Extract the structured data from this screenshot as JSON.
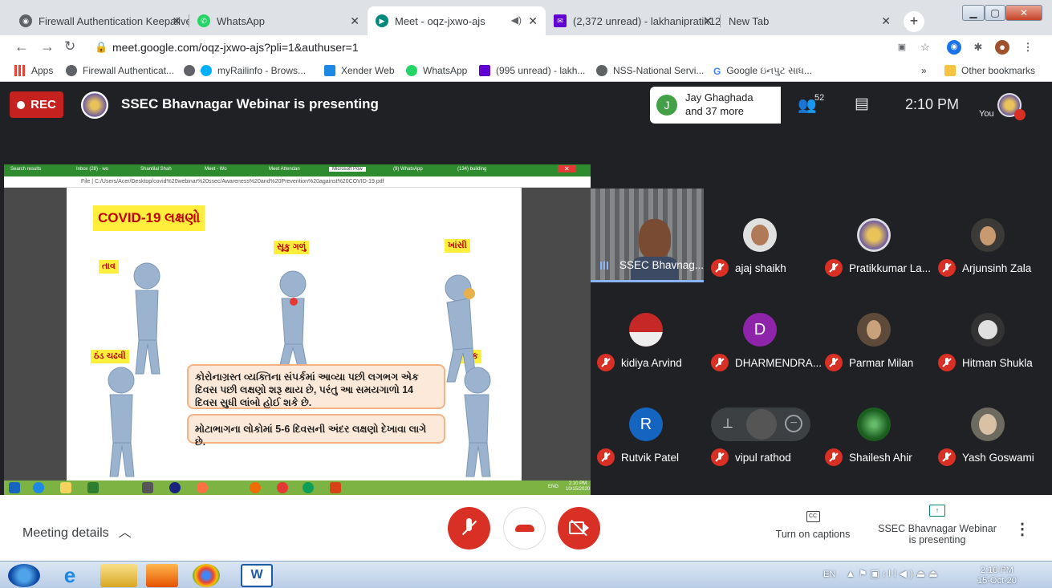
{
  "browser": {
    "tabs": [
      {
        "title": "Firewall Authentication Keepalive",
        "icon": "globe-icon"
      },
      {
        "title": "WhatsApp",
        "icon": "whatsapp-icon"
      },
      {
        "title": "Meet - oqz-jxwo-ajs",
        "icon": "meet-icon",
        "active": true
      },
      {
        "title": "(2,372 unread) - lakhanipratik12",
        "icon": "mail-icon"
      },
      {
        "title": "New Tab",
        "icon": ""
      }
    ],
    "url": "meet.google.com/oqz-jxwo-ajs?pli=1&authuser=1",
    "bookmarks": [
      "Apps",
      "Firewall Authenticat...",
      "myRailinfo - Brows...",
      "Xender Web",
      "WhatsApp",
      "(995 unread) - lakh...",
      "NSS-National Servi...",
      "Google ઇનપુટ સાધ..."
    ],
    "other_bookmarks": "Other bookmarks",
    "more_chevron": "»"
  },
  "meet": {
    "rec_label": "REC",
    "presenting_title": "SSEC Bhavnagar Webinar is presenting",
    "participants_summary_line1": "Jay Ghaghada",
    "participants_summary_line2": "and 37 more",
    "participant_count": "52",
    "time": "2:10 PM",
    "you_label": "You",
    "participants": [
      {
        "name": "SSEC Bhavnag...",
        "speaking": true
      },
      {
        "name": "ajaj shaikh"
      },
      {
        "name": "Pratikkumar La..."
      },
      {
        "name": "Arjunsinh Zala"
      },
      {
        "name": "kidiya Arvind"
      },
      {
        "name": "DHARMENDRA...",
        "initial": "D"
      },
      {
        "name": "Parmar Milan"
      },
      {
        "name": "Hitman Shukla"
      },
      {
        "name": "Rutvik Patel",
        "initial": "R"
      },
      {
        "name": "vipul rathod"
      },
      {
        "name": "Shailesh Ahir"
      },
      {
        "name": "Yash Goswami"
      }
    ],
    "bottom": {
      "meeting_details": "Meeting details",
      "captions": "Turn on captions",
      "captions_icon_text": "CC",
      "presenting_line1": "SSEC Bhavnagar Webinar",
      "presenting_line2": "is presenting"
    }
  },
  "shared_screen": {
    "inner_tabs": [
      "Search results",
      "Inbox (28) - wo",
      "Shantilal Shah",
      "Meet - Wo",
      "Meet Attendan",
      "Microsoft Pow",
      "(9) WhatsApp",
      "(134) building"
    ],
    "inner_url": "File | C:/Users/Acer/Desktop/covid%20webinar%20ssec/Awareness%20and%20Prevention%20against%20COVID-19.pdf",
    "slide": {
      "title": "COVID-19 લક્ષણો",
      "labels": [
        "તાવ",
        "સૂકુ ગળું",
        "ખાંસી",
        "ઠંડ ચઢવી",
        "થાક"
      ],
      "box1": "કોરોનાગ્રસ્ત વ્યક્તિના સંપર્કમાં આવ્યા પછી લગભગ એક દિવસ પછી લક્ષણો શરૂ થાય છે, પરંતુ આ સમયગાળો 14 દિવસ સુધી લાંબો હોઈ શકે છે.",
      "box2": "મોટાભાગના લોકોમાં 5-6 દિવસની અંદર લક્ષણો દેખાવા લાગે છે."
    },
    "inner_clock_time": "2:10 PM",
    "inner_clock_date": "10/15/2020",
    "inner_lang": "ENG"
  },
  "taskbar": {
    "lang": "EN",
    "time": "2:10 PM",
    "date": "15-Oct-20"
  }
}
